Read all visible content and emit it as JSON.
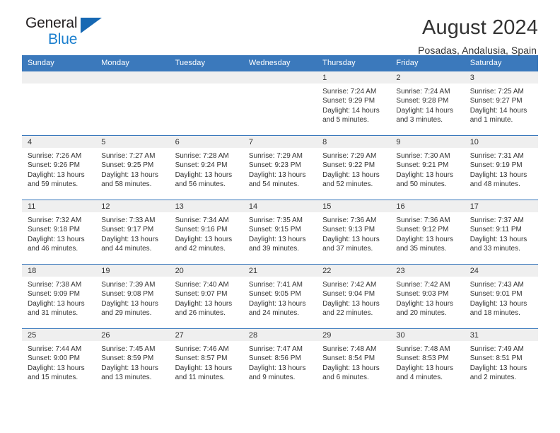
{
  "brand": {
    "name_top": "General",
    "name_bottom": "Blue",
    "triangle_color": "#1668b3",
    "blue_color": "#1b7fce"
  },
  "header": {
    "title": "August 2024",
    "subtitle": "Posadas, Andalusia, Spain"
  },
  "theme": {
    "header_row_bg": "#3b79bc",
    "daynum_band_bg": "#efefef",
    "text_color": "#333333"
  },
  "weekday_headers": [
    "Sunday",
    "Monday",
    "Tuesday",
    "Wednesday",
    "Thursday",
    "Friday",
    "Saturday"
  ],
  "labels": {
    "sunrise_prefix": "Sunrise:",
    "sunset_prefix": "Sunset:",
    "daylight_prefix": "Daylight:"
  },
  "weeks": [
    [
      {
        "empty": true
      },
      {
        "empty": true
      },
      {
        "empty": true
      },
      {
        "empty": true
      },
      {
        "day": "1",
        "sunrise": "Sunrise: 7:24 AM",
        "sunset": "Sunset: 9:29 PM",
        "daylight1": "Daylight: 14 hours",
        "daylight2": "and 5 minutes."
      },
      {
        "day": "2",
        "sunrise": "Sunrise: 7:24 AM",
        "sunset": "Sunset: 9:28 PM",
        "daylight1": "Daylight: 14 hours",
        "daylight2": "and 3 minutes."
      },
      {
        "day": "3",
        "sunrise": "Sunrise: 7:25 AM",
        "sunset": "Sunset: 9:27 PM",
        "daylight1": "Daylight: 14 hours",
        "daylight2": "and 1 minute."
      }
    ],
    [
      {
        "day": "4",
        "sunrise": "Sunrise: 7:26 AM",
        "sunset": "Sunset: 9:26 PM",
        "daylight1": "Daylight: 13 hours",
        "daylight2": "and 59 minutes."
      },
      {
        "day": "5",
        "sunrise": "Sunrise: 7:27 AM",
        "sunset": "Sunset: 9:25 PM",
        "daylight1": "Daylight: 13 hours",
        "daylight2": "and 58 minutes."
      },
      {
        "day": "6",
        "sunrise": "Sunrise: 7:28 AM",
        "sunset": "Sunset: 9:24 PM",
        "daylight1": "Daylight: 13 hours",
        "daylight2": "and 56 minutes."
      },
      {
        "day": "7",
        "sunrise": "Sunrise: 7:29 AM",
        "sunset": "Sunset: 9:23 PM",
        "daylight1": "Daylight: 13 hours",
        "daylight2": "and 54 minutes."
      },
      {
        "day": "8",
        "sunrise": "Sunrise: 7:29 AM",
        "sunset": "Sunset: 9:22 PM",
        "daylight1": "Daylight: 13 hours",
        "daylight2": "and 52 minutes."
      },
      {
        "day": "9",
        "sunrise": "Sunrise: 7:30 AM",
        "sunset": "Sunset: 9:21 PM",
        "daylight1": "Daylight: 13 hours",
        "daylight2": "and 50 minutes."
      },
      {
        "day": "10",
        "sunrise": "Sunrise: 7:31 AM",
        "sunset": "Sunset: 9:19 PM",
        "daylight1": "Daylight: 13 hours",
        "daylight2": "and 48 minutes."
      }
    ],
    [
      {
        "day": "11",
        "sunrise": "Sunrise: 7:32 AM",
        "sunset": "Sunset: 9:18 PM",
        "daylight1": "Daylight: 13 hours",
        "daylight2": "and 46 minutes."
      },
      {
        "day": "12",
        "sunrise": "Sunrise: 7:33 AM",
        "sunset": "Sunset: 9:17 PM",
        "daylight1": "Daylight: 13 hours",
        "daylight2": "and 44 minutes."
      },
      {
        "day": "13",
        "sunrise": "Sunrise: 7:34 AM",
        "sunset": "Sunset: 9:16 PM",
        "daylight1": "Daylight: 13 hours",
        "daylight2": "and 42 minutes."
      },
      {
        "day": "14",
        "sunrise": "Sunrise: 7:35 AM",
        "sunset": "Sunset: 9:15 PM",
        "daylight1": "Daylight: 13 hours",
        "daylight2": "and 39 minutes."
      },
      {
        "day": "15",
        "sunrise": "Sunrise: 7:36 AM",
        "sunset": "Sunset: 9:13 PM",
        "daylight1": "Daylight: 13 hours",
        "daylight2": "and 37 minutes."
      },
      {
        "day": "16",
        "sunrise": "Sunrise: 7:36 AM",
        "sunset": "Sunset: 9:12 PM",
        "daylight1": "Daylight: 13 hours",
        "daylight2": "and 35 minutes."
      },
      {
        "day": "17",
        "sunrise": "Sunrise: 7:37 AM",
        "sunset": "Sunset: 9:11 PM",
        "daylight1": "Daylight: 13 hours",
        "daylight2": "and 33 minutes."
      }
    ],
    [
      {
        "day": "18",
        "sunrise": "Sunrise: 7:38 AM",
        "sunset": "Sunset: 9:09 PM",
        "daylight1": "Daylight: 13 hours",
        "daylight2": "and 31 minutes."
      },
      {
        "day": "19",
        "sunrise": "Sunrise: 7:39 AM",
        "sunset": "Sunset: 9:08 PM",
        "daylight1": "Daylight: 13 hours",
        "daylight2": "and 29 minutes."
      },
      {
        "day": "20",
        "sunrise": "Sunrise: 7:40 AM",
        "sunset": "Sunset: 9:07 PM",
        "daylight1": "Daylight: 13 hours",
        "daylight2": "and 26 minutes."
      },
      {
        "day": "21",
        "sunrise": "Sunrise: 7:41 AM",
        "sunset": "Sunset: 9:05 PM",
        "daylight1": "Daylight: 13 hours",
        "daylight2": "and 24 minutes."
      },
      {
        "day": "22",
        "sunrise": "Sunrise: 7:42 AM",
        "sunset": "Sunset: 9:04 PM",
        "daylight1": "Daylight: 13 hours",
        "daylight2": "and 22 minutes."
      },
      {
        "day": "23",
        "sunrise": "Sunrise: 7:42 AM",
        "sunset": "Sunset: 9:03 PM",
        "daylight1": "Daylight: 13 hours",
        "daylight2": "and 20 minutes."
      },
      {
        "day": "24",
        "sunrise": "Sunrise: 7:43 AM",
        "sunset": "Sunset: 9:01 PM",
        "daylight1": "Daylight: 13 hours",
        "daylight2": "and 18 minutes."
      }
    ],
    [
      {
        "day": "25",
        "sunrise": "Sunrise: 7:44 AM",
        "sunset": "Sunset: 9:00 PM",
        "daylight1": "Daylight: 13 hours",
        "daylight2": "and 15 minutes."
      },
      {
        "day": "26",
        "sunrise": "Sunrise: 7:45 AM",
        "sunset": "Sunset: 8:59 PM",
        "daylight1": "Daylight: 13 hours",
        "daylight2": "and 13 minutes."
      },
      {
        "day": "27",
        "sunrise": "Sunrise: 7:46 AM",
        "sunset": "Sunset: 8:57 PM",
        "daylight1": "Daylight: 13 hours",
        "daylight2": "and 11 minutes."
      },
      {
        "day": "28",
        "sunrise": "Sunrise: 7:47 AM",
        "sunset": "Sunset: 8:56 PM",
        "daylight1": "Daylight: 13 hours",
        "daylight2": "and 9 minutes."
      },
      {
        "day": "29",
        "sunrise": "Sunrise: 7:48 AM",
        "sunset": "Sunset: 8:54 PM",
        "daylight1": "Daylight: 13 hours",
        "daylight2": "and 6 minutes."
      },
      {
        "day": "30",
        "sunrise": "Sunrise: 7:48 AM",
        "sunset": "Sunset: 8:53 PM",
        "daylight1": "Daylight: 13 hours",
        "daylight2": "and 4 minutes."
      },
      {
        "day": "31",
        "sunrise": "Sunrise: 7:49 AM",
        "sunset": "Sunset: 8:51 PM",
        "daylight1": "Daylight: 13 hours",
        "daylight2": "and 2 minutes."
      }
    ]
  ]
}
